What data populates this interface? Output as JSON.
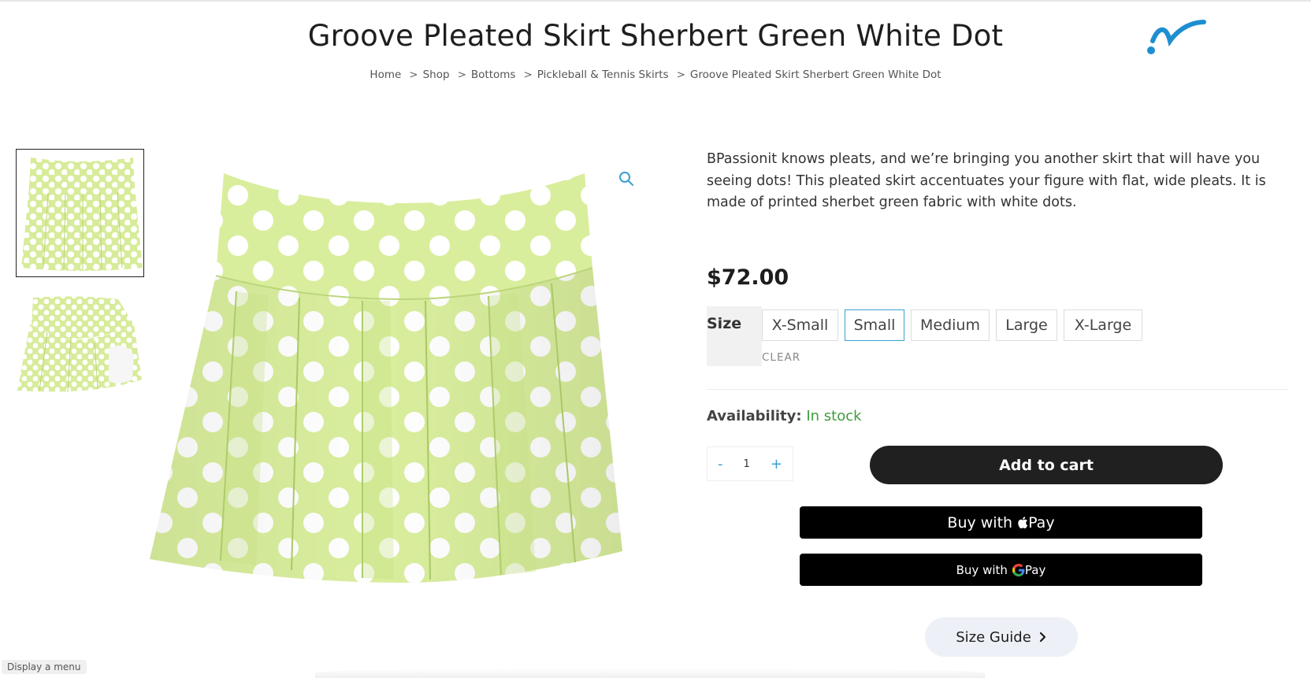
{
  "header": {
    "title": "Groove Pleated Skirt Sherbert Green White Dot",
    "logo_icon": "brand-swoosh-icon",
    "accent_color": "#1d8fd1"
  },
  "breadcrumb": {
    "items": [
      "Home",
      "Shop",
      "Bottoms",
      "Pickleball & Tennis Skirts",
      "Groove Pleated Skirt Sherbert Green White Dot"
    ],
    "separator": ">"
  },
  "gallery": {
    "thumbnails": [
      "skirt-front",
      "skirt-side"
    ],
    "zoom_icon": "magnifier-icon"
  },
  "product": {
    "description": "BPassionit knows pleats, and we’re bringing you another skirt that will have you seeing dots! This pleated skirt accentuates your figure with flat, wide pleats. It is made of printed sherbet green fabric with white dots.",
    "price": "$72.00",
    "size_label": "Size",
    "sizes": [
      "X-Small",
      "Small",
      "Medium",
      "Large",
      "X-Large"
    ],
    "selected_size": "Small",
    "clear_label": "CLEAR",
    "availability_label": "Availability:",
    "availability_value": "In stock",
    "availability_color": "#3f9b3f",
    "qty_minus": "-",
    "qty_value": "1",
    "qty_plus": "+",
    "add_to_cart_label": "Add to cart",
    "apple_pay_label": "Buy with",
    "apple_pay_brand": "Pay",
    "google_pay_label": "Buy with",
    "google_pay_brand": "Pay",
    "size_guide_label": "Size Guide",
    "size_guide_icon": "chevron-right-icon"
  },
  "status": {
    "hint": "Display a menu"
  }
}
